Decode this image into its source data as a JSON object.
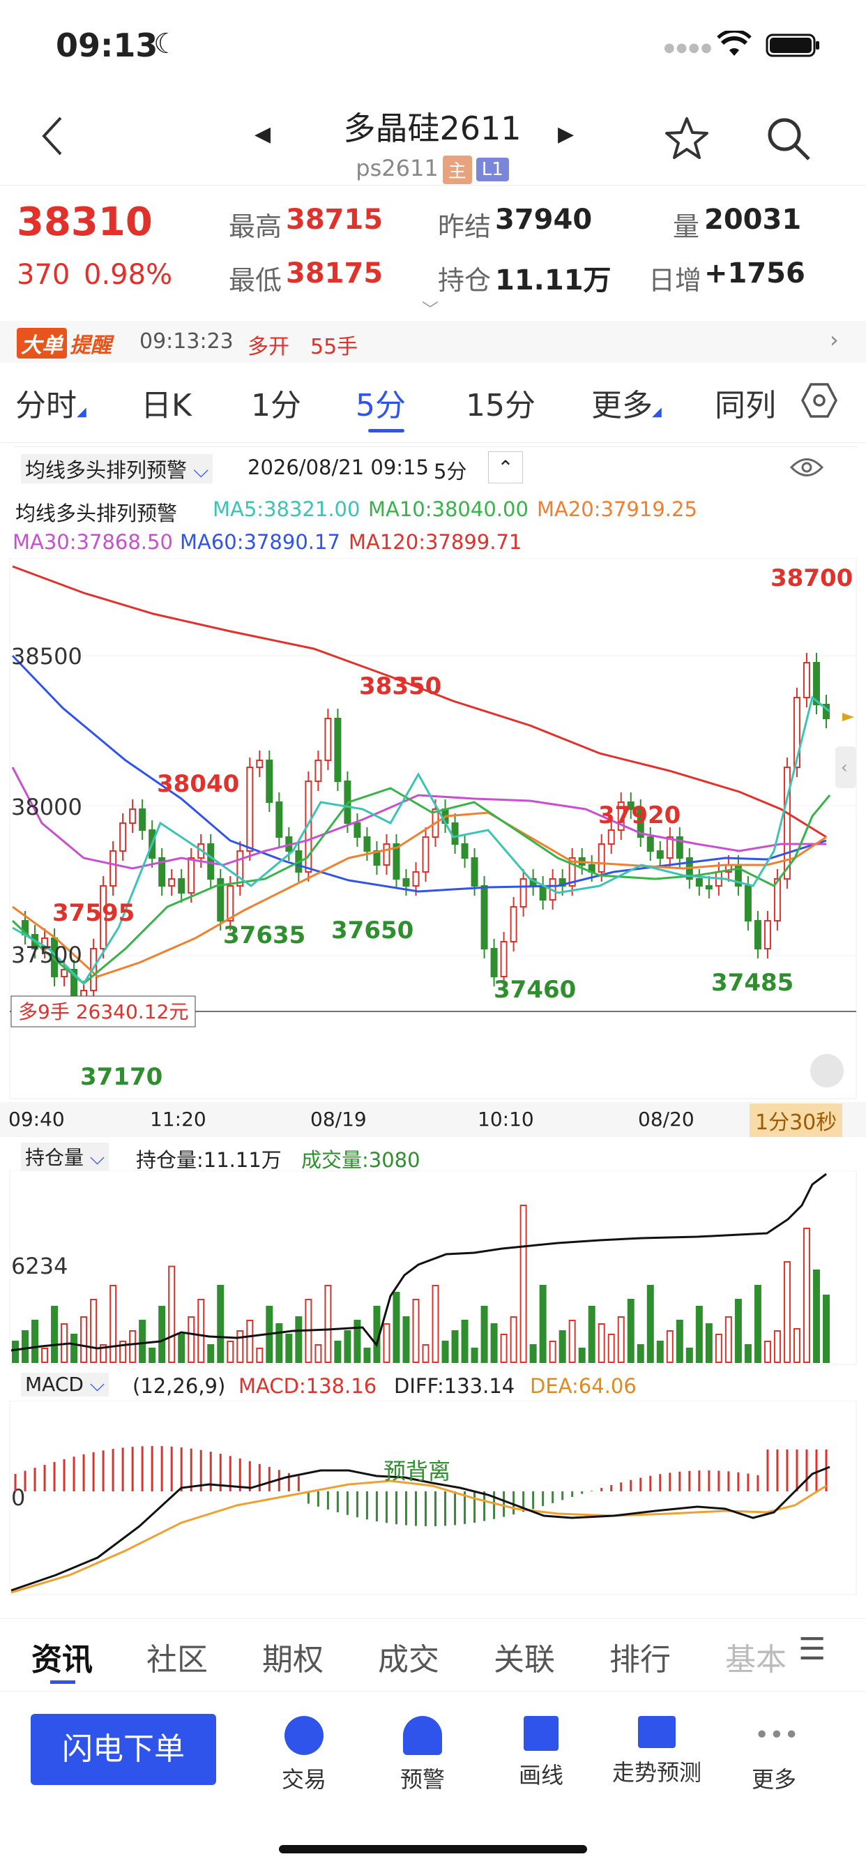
{
  "status": {
    "time": "09:13"
  },
  "nav": {
    "title": "多晶硅2611",
    "code": "ps2611",
    "tag_main": "主",
    "tag_l1": "L1"
  },
  "quote": {
    "price": "38310",
    "change": "370",
    "change_pct": "0.98%",
    "high_label": "最高",
    "high": "38715",
    "low_label": "最低",
    "low": "38175",
    "prev_label": "昨结",
    "prev": "37940",
    "oi_label": "持仓",
    "oi": "11.11万",
    "vol_label": "量",
    "vol": "20031",
    "daily_label": "日增",
    "daily": "+1756"
  },
  "alert": {
    "badge": "大单",
    "badge2": "提醒",
    "time": "09:13:23",
    "type": "多开",
    "qty": "55手"
  },
  "tabs": [
    "分时",
    "日K",
    "1分",
    "5分",
    "15分",
    "更多",
    "同列"
  ],
  "indicator": {
    "name": "均线多头排列预警",
    "datetime": "2026/08/21 09:15",
    "period": "5分",
    "label": "均线多头排列预警",
    "ma5": "MA5:38321.00",
    "ma10": "MA10:38040.00",
    "ma20": "MA20:37919.25",
    "ma30": "MA30:37868.50",
    "ma60": "MA60:37890.17",
    "ma120": "MA120:37899.71"
  },
  "chart_annotations": {
    "p38700": "38700",
    "p38350": "38350",
    "p38040": "38040",
    "p37920": "37920",
    "p37595": "37595",
    "p37635": "37635",
    "p37650": "37650",
    "p37460": "37460",
    "p37485": "37485",
    "p37170": "37170",
    "y38500": "38500",
    "y38000": "38000",
    "y37500": "37500",
    "position": "多9手 26340.12元",
    "countdown": "1分30秒"
  },
  "x_axis": [
    "09:40",
    "11:20",
    "08/19",
    "10:10",
    "08/20"
  ],
  "oi_panel": {
    "selector": "持仓量",
    "oi": "持仓量:11.11万",
    "vol": "成交量:3080",
    "ytick": "6234"
  },
  "macd_panel": {
    "selector": "MACD",
    "params": "(12,26,9)",
    "macd": "MACD:138.16",
    "diff": "DIFF:133.14",
    "dea": "DEA:64.06",
    "ytick": "0",
    "note": "预背离"
  },
  "bottom_tabs": [
    "资讯",
    "社区",
    "期权",
    "成交",
    "关联",
    "排行",
    "基本"
  ],
  "toolbar": {
    "order": "闪电下单",
    "trade": "交易",
    "alert": "预警",
    "draw": "画线",
    "forecast": "走势预测",
    "more": "更多"
  },
  "chart_data": {
    "type": "candlestick",
    "y_axis_ticks": [
      37500,
      38000,
      38500
    ],
    "annotated_high": 38700,
    "annotated_lows": [
      37170,
      37460,
      37485,
      37635,
      37650
    ],
    "annotated_peaks": [
      37595,
      38040,
      38350,
      37920,
      38700
    ],
    "ma": {
      "MA5": 38321.0,
      "MA10": 38040.0,
      "MA20": 37919.25,
      "MA30": 37868.5,
      "MA60": 37890.17,
      "MA120": 37899.71
    }
  }
}
